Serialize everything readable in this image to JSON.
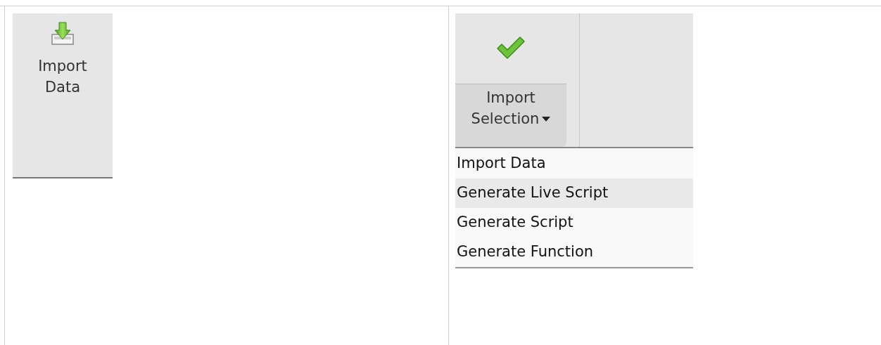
{
  "import_button": {
    "label": "Import Data"
  },
  "selection_button": {
    "label": "Import Selection",
    "expanded": true
  },
  "menu": {
    "items": [
      {
        "label": "Import Data",
        "selected": false
      },
      {
        "label": "Generate Live Script",
        "selected": true
      },
      {
        "label": "Generate Script",
        "selected": false
      },
      {
        "label": "Generate Function",
        "selected": false
      }
    ]
  }
}
